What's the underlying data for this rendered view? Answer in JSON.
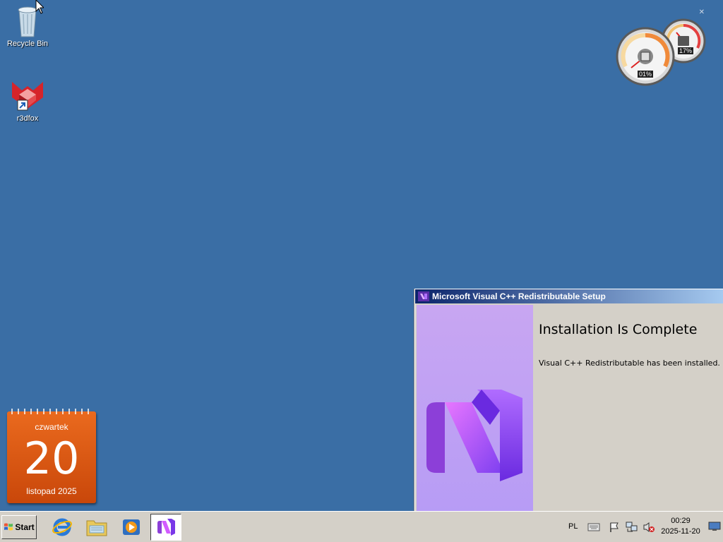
{
  "desktop": {
    "icons": [
      {
        "label": "Recycle Bin",
        "icon": "recycle-bin-icon"
      },
      {
        "label": "r3dfox",
        "icon": "r3dfox-icon"
      }
    ]
  },
  "gauges": {
    "cpu_percent": "01%",
    "memory_percent": "17%"
  },
  "calendar": {
    "weekday": "czwartek",
    "day": "20",
    "month_year": "listopad 2025"
  },
  "setup_window": {
    "title": "Microsoft Visual C++ Redistributable Setup",
    "heading": "Installation Is Complete",
    "message": "Visual C++ Redistributable has been installed."
  },
  "taskbar": {
    "start_label": "Start",
    "pinned": [
      {
        "name": "internet-explorer-icon"
      },
      {
        "name": "windows-explorer-icon"
      },
      {
        "name": "media-player-icon"
      },
      {
        "name": "visual-studio-installer-icon"
      }
    ],
    "language": "PL",
    "time": "00:29",
    "date": "2025-11-20"
  },
  "colors": {
    "desktop_bg": "#3a6ea5",
    "titlebar_start": "#0a246a",
    "titlebar_end": "#a6caf0",
    "calendar_orange": "#e3621a",
    "vs_purple": "#8b4fd6"
  }
}
